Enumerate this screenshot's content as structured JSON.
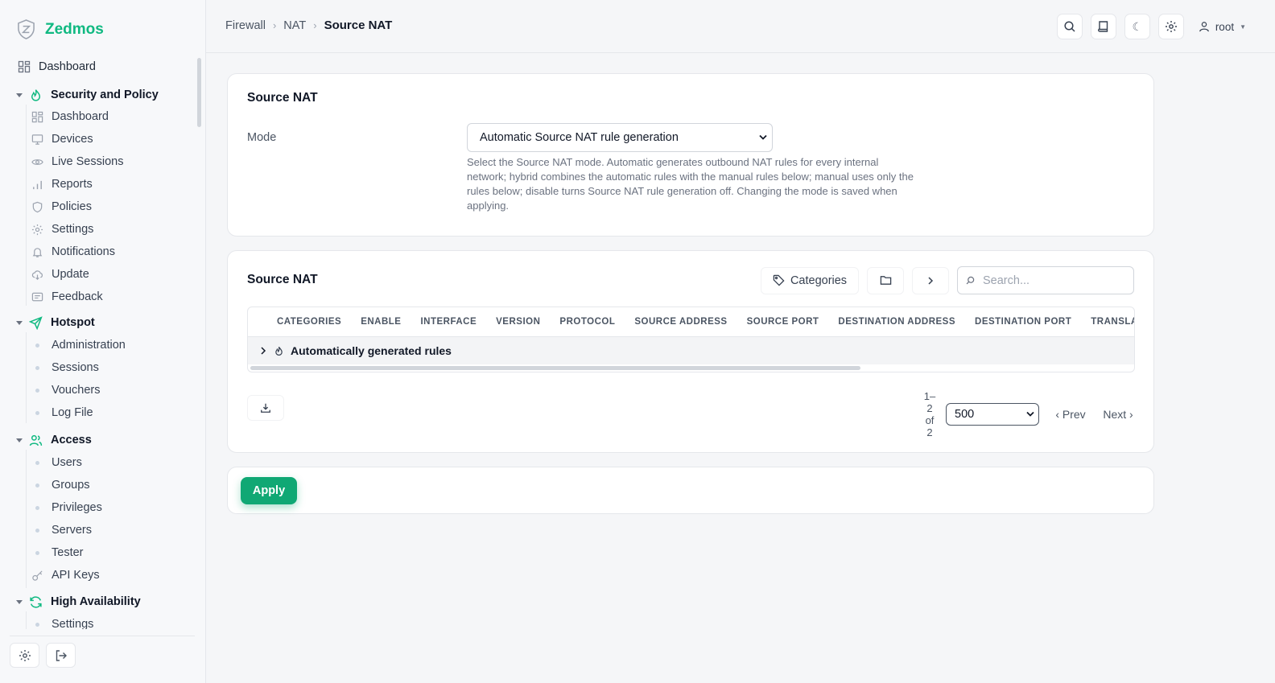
{
  "app": {
    "brand": "Zedmos"
  },
  "sidebar": {
    "top_item": "Dashboard",
    "sections": [
      {
        "title": "Security and Policy",
        "items": [
          "Dashboard",
          "Devices",
          "Live Sessions",
          "Reports",
          "Policies",
          "Settings",
          "Notifications",
          "Update",
          "Feedback"
        ]
      },
      {
        "title": "Hotspot",
        "items": [
          "Administration",
          "Sessions",
          "Vouchers",
          "Log File"
        ]
      },
      {
        "title": "Access",
        "items": [
          "Users",
          "Groups",
          "Privileges",
          "Servers",
          "Tester",
          "API Keys"
        ]
      },
      {
        "title": "High Availability",
        "items": [
          "Settings"
        ]
      }
    ]
  },
  "breadcrumb": [
    "Firewall",
    "NAT",
    "Source NAT"
  ],
  "topbar": {
    "user": "root"
  },
  "mode_card": {
    "title": "Source NAT",
    "label": "Mode",
    "value": "Automatic Source NAT rule generation",
    "help": "Select the Source NAT mode. Automatic generates outbound NAT rules for every internal network; hybrid combines the automatic rules with the manual rules below; manual uses only the rules below; disable turns Source NAT rule generation off. Changing the mode is saved when applying."
  },
  "rules_card": {
    "title": "Source NAT",
    "categories_label": "Categories",
    "search_placeholder": "Search...",
    "columns": [
      "Categories",
      "Enable",
      "Interface",
      "Version",
      "Protocol",
      "Source Address",
      "Source Port",
      "Destination Address",
      "Destination Port",
      "Translate"
    ],
    "group_row": "Automatically generated rules",
    "pagination": {
      "range": "1–2 of 2",
      "per_page": "500",
      "prev": "‹ Prev",
      "next": "Next ›"
    }
  },
  "apply_label": "Apply",
  "colors": {
    "accent": "#10b981",
    "apply": "#10a874"
  }
}
